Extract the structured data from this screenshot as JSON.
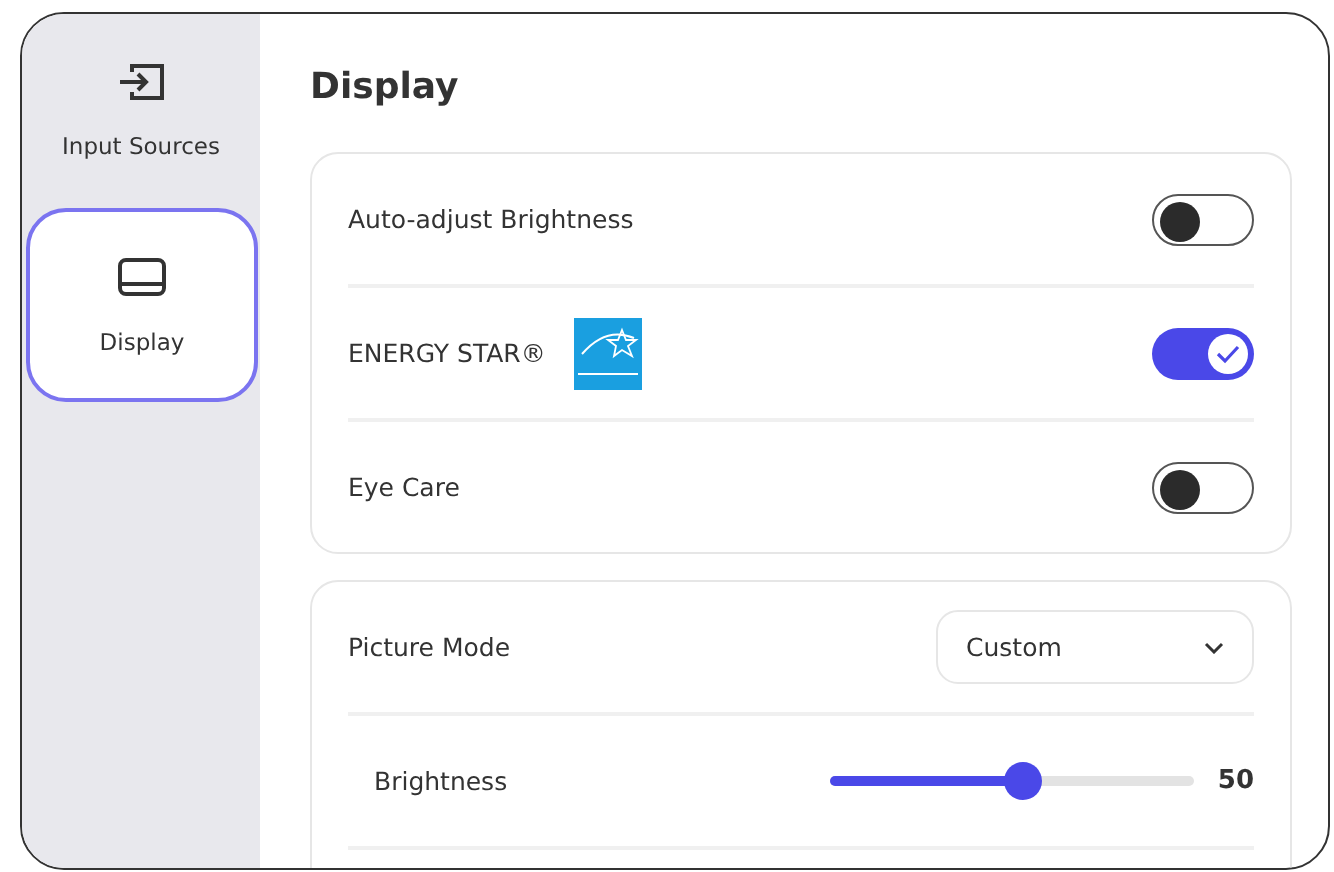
{
  "sidebar": {
    "items": [
      {
        "label": "Input Sources",
        "selected": false
      },
      {
        "label": "Display",
        "selected": true
      }
    ]
  },
  "title": "Display",
  "toggles": [
    {
      "label": "Auto-adjust Brightness",
      "on": false,
      "logo": false
    },
    {
      "label": "ENERGY STAR®",
      "on": true,
      "logo": true
    },
    {
      "label": "Eye Care",
      "on": false,
      "logo": false
    }
  ],
  "picture_mode": {
    "label": "Picture Mode",
    "value": "Custom"
  },
  "brightness": {
    "label": "Brightness",
    "level": 0.53,
    "reading": "50"
  }
}
